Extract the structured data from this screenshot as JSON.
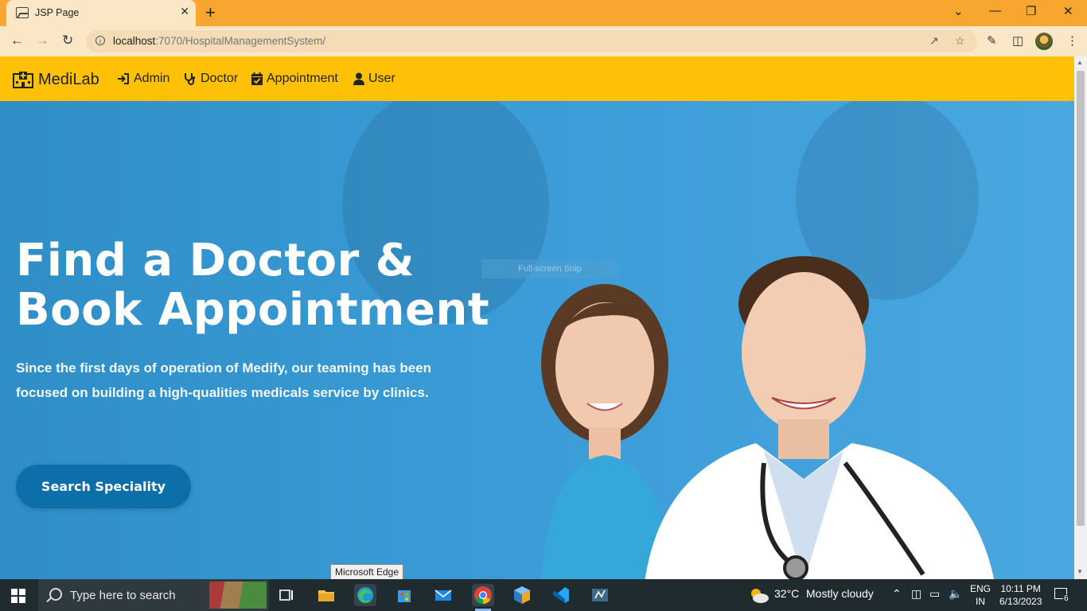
{
  "browser": {
    "tab_title": "JSP Page",
    "tab_close": "✕",
    "new_tab": "+",
    "url_host": "localhost",
    "url_rest": ":7070/HospitalManagementSystem/",
    "window_controls": [
      "⌄",
      "—",
      "❐",
      "✕"
    ]
  },
  "navbar": {
    "brand": "MediLab",
    "links": [
      {
        "label": "Admin",
        "icon": "sign-in-icon"
      },
      {
        "label": "Doctor",
        "icon": "stethoscope-icon"
      },
      {
        "label": "Appointment",
        "icon": "calendar-check-icon"
      },
      {
        "label": "User",
        "icon": "user-icon"
      }
    ]
  },
  "hero": {
    "heading_line1": "Find a Doctor &",
    "heading_line2": "Book Appointment",
    "description": "Since the first days of operation of Medify, our teaming has been focused on building a high-qualities medicals service by clinics.",
    "cta": "Search Speciality",
    "snip_overlay": "Full-screen Snip"
  },
  "tooltip": "Microsoft Edge",
  "taskbar": {
    "search_placeholder": "Type here to search",
    "weather_temp": "32°C",
    "weather_desc": "Mostly cloudy",
    "lang_line1": "ENG",
    "lang_line2": "IN",
    "time": "10:11 PM",
    "date": "6/13/2023",
    "notification_count": "6"
  },
  "colors": {
    "titlebar": "#f7a630",
    "navbar": "#ffc107",
    "hero": "#3a9bd6",
    "cta": "#0d6fa9"
  }
}
